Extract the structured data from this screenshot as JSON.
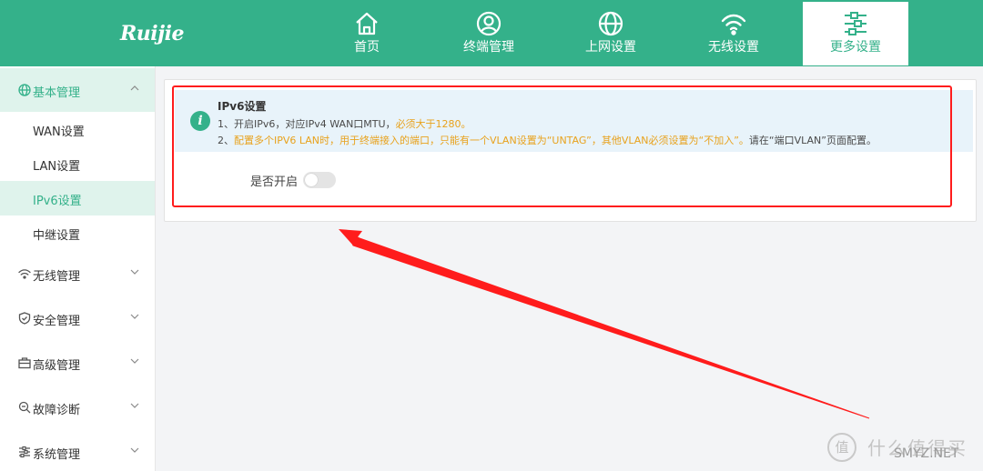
{
  "brand": {
    "logo_text": "Ruijie"
  },
  "nav": {
    "tabs": [
      {
        "label": "首页",
        "icon": "home-icon"
      },
      {
        "label": "终端管理",
        "icon": "user-circle-icon"
      },
      {
        "label": "上网设置",
        "icon": "globe-icon"
      },
      {
        "label": "无线设置",
        "icon": "wifi-icon"
      },
      {
        "label": "更多设置",
        "icon": "sliders-icon",
        "active": true
      }
    ]
  },
  "sidebar": {
    "groups": [
      {
        "label": "基本管理",
        "icon": "globe-icon",
        "expanded": true
      },
      {
        "label": "无线管理",
        "icon": "wifi-icon"
      },
      {
        "label": "安全管理",
        "icon": "shield-icon"
      },
      {
        "label": "高级管理",
        "icon": "briefcase-icon"
      },
      {
        "label": "故障诊断",
        "icon": "search-icon"
      },
      {
        "label": "系统管理",
        "icon": "sliders-icon"
      }
    ],
    "items": [
      {
        "label": "WAN设置"
      },
      {
        "label": "LAN设置"
      },
      {
        "label": "IPv6设置",
        "active": true
      },
      {
        "label": "中继设置"
      }
    ]
  },
  "panel": {
    "title": "IPv6设置",
    "line1_text": "1、开启IPv6，对应IPv4 WAN口MTU，",
    "line1_warn": "必须大于1280。",
    "line2_num": "2、",
    "line2_warn": "配置多个IPV6 LAN时，用于终端接入的端口，只能有一个VLAN设置为“UNTAG”，其他VLAN必须设置为“不加入”。",
    "line2_text": "请在“端口VLAN”页面配置。",
    "toggle_label": "是否开启",
    "toggle_on": false
  },
  "watermark": {
    "text": "什么值得买",
    "url": "SMYZ.NET",
    "icon_char": "值"
  },
  "colors": {
    "brand_green": "#34b18a",
    "highlight_red": "#ff1c1c",
    "warn_orange": "#e8a21c",
    "info_bg": "#e8f3fa"
  }
}
